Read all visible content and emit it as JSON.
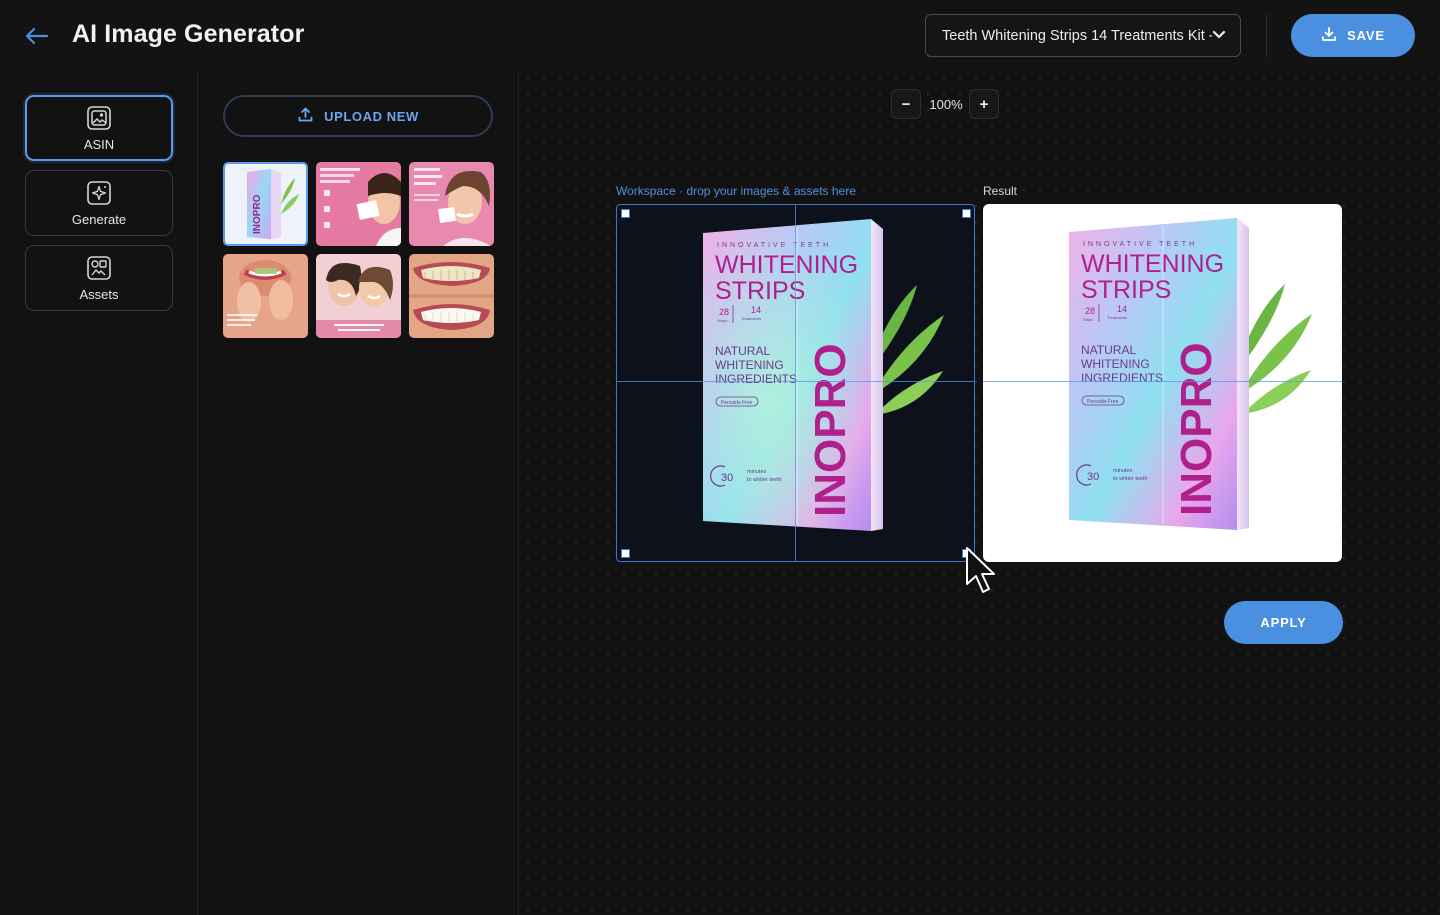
{
  "header": {
    "title": "AI Image Generator",
    "product_select": "Teeth Whitening Strips 14 Treatments Kit -...",
    "save_label": "SAVE"
  },
  "nav": {
    "items": [
      {
        "label": "ASIN",
        "icon": "image-icon",
        "active": true
      },
      {
        "label": "Generate",
        "icon": "sparkle-icon",
        "active": false
      },
      {
        "label": "Assets",
        "icon": "assets-icon",
        "active": false
      }
    ]
  },
  "assets": {
    "upload_label": "UPLOAD NEW",
    "thumbnails": [
      {
        "name": "product-box",
        "selected": true
      },
      {
        "name": "woman-holding-strip",
        "selected": false
      },
      {
        "name": "woman-smiling-card",
        "selected": false
      },
      {
        "name": "applying-strip",
        "selected": false
      },
      {
        "name": "two-women-smiling",
        "selected": false
      },
      {
        "name": "teeth-closeup",
        "selected": false
      }
    ]
  },
  "canvas": {
    "zoom": "100%",
    "zoom_out": "−",
    "zoom_in": "+",
    "workspace_label": "Workspace · drop your images & assets here",
    "result_label": "Result",
    "apply_label": "APPLY"
  },
  "product": {
    "tagline": "INNOVATIVE TEETH",
    "name_line1": "WHITENING",
    "name_line2": "STRIPS",
    "strips_count": "28",
    "strips_word": "Strips",
    "treatments_count": "14",
    "treatments_word": "Treatments",
    "natural_1": "NATURAL",
    "natural_2": "WHITENING",
    "natural_3": "INGREDIENTS",
    "peroxide": "Peroxide Free",
    "minutes": "30",
    "minutes_text_1": "minutes",
    "minutes_text_2": "to whiter teeth",
    "brand": "INOPRO"
  },
  "colors": {
    "accent": "#4a8fe0",
    "background": "#121212",
    "leaf": "#7bc24a"
  }
}
